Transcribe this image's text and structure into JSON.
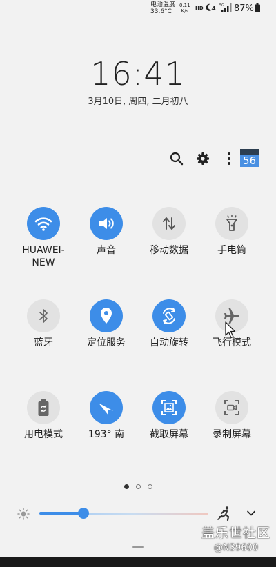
{
  "status_bar": {
    "temp_label": "电池温度",
    "temp_value": "33.6°C",
    "speed_value": "0.11",
    "speed_unit": "K/s",
    "hd": "HD",
    "net": "4",
    "battery": "87%"
  },
  "clock": {
    "time": "16:41",
    "date": "3月10日, 周四, 二月初八"
  },
  "top_actions": {
    "badge": "56"
  },
  "tiles": [
    {
      "label": "HUAWEI-\nNEW",
      "icon": "wifi-icon",
      "on": true
    },
    {
      "label": "声音",
      "icon": "volume-icon",
      "on": true
    },
    {
      "label": "移动数据",
      "icon": "mobile-data-icon",
      "on": false
    },
    {
      "label": "手电筒",
      "icon": "flashlight-icon",
      "on": false
    },
    {
      "label": "蓝牙",
      "icon": "bluetooth-icon",
      "on": false
    },
    {
      "label": "定位服务",
      "icon": "location-icon",
      "on": true
    },
    {
      "label": "自动旋转",
      "icon": "auto-rotate-icon",
      "on": true
    },
    {
      "label": "飞行模式",
      "icon": "airplane-icon",
      "on": false
    },
    {
      "label": "用电模式",
      "icon": "power-mode-icon",
      "on": false
    },
    {
      "label": "193° 南",
      "icon": "compass-icon",
      "on": true
    },
    {
      "label": "截取屏幕",
      "icon": "screenshot-icon",
      "on": true
    },
    {
      "label": "录制屏幕",
      "icon": "screen-record-icon",
      "on": false
    }
  ],
  "brightness": {
    "level": 0.26
  },
  "watermark": {
    "title": "盖乐世社区",
    "user": "@N39600"
  },
  "colors": {
    "accent": "#3d8de8",
    "tile_off": "#e2e2e2",
    "background": "#f2f2f2"
  }
}
